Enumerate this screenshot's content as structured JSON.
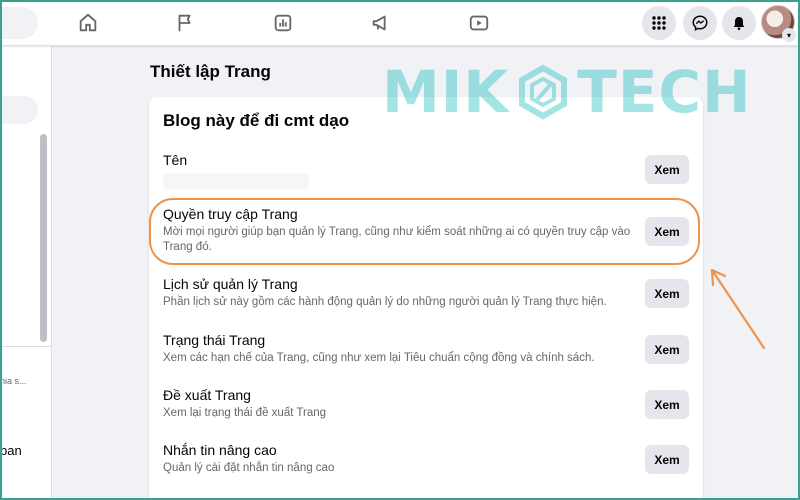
{
  "colors": {
    "page_bg": "#f0f2f5",
    "card_bg": "#ffffff",
    "button_bg": "#e4e6eb",
    "highlight": "#f0934a",
    "watermark": "#27c0c0",
    "frame": "#3aa08f"
  },
  "topbar": {
    "nav_icons": [
      "home-icon",
      "flag-icon",
      "insights-icon",
      "megaphone-icon",
      "video-icon"
    ],
    "right_icons": [
      "grid-menu-icon",
      "messenger-icon",
      "bell-icon"
    ]
  },
  "sidebar": {
    "text_1": "hia s...",
    "text_2": "ban"
  },
  "main": {
    "section_title": "Thiết lập Trang",
    "card_title": "Blog này để đi cmt dạo",
    "rows": [
      {
        "label": "Tên",
        "desc": "",
        "button": "Xem"
      },
      {
        "label": "Quyền truy cập Trang",
        "desc": "Mời mọi người giúp bạn quản lý Trang, cũng như kiểm soát những ai có quyền truy cập vào Trang đó.",
        "button": "Xem"
      },
      {
        "label": "Lịch sử quản lý Trang",
        "desc": "Phần lịch sử này gồm các hành động quản lý do những người quản lý Trang thực hiện.",
        "button": "Xem"
      },
      {
        "label": "Trạng thái Trang",
        "desc": "Xem các hạn chế của Trang, cũng như xem lại Tiêu chuẩn cộng đồng và chính sách.",
        "button": "Xem"
      },
      {
        "label": "Đề xuất Trang",
        "desc": "Xem lại trạng thái đề xuất Trang",
        "button": "Xem"
      },
      {
        "label": "Nhắn tin nâng cao",
        "desc": "Quản lý cài đặt nhắn tin nâng cao",
        "button": "Xem"
      }
    ]
  },
  "watermark": {
    "left": "MIK",
    "right": "TECH"
  }
}
